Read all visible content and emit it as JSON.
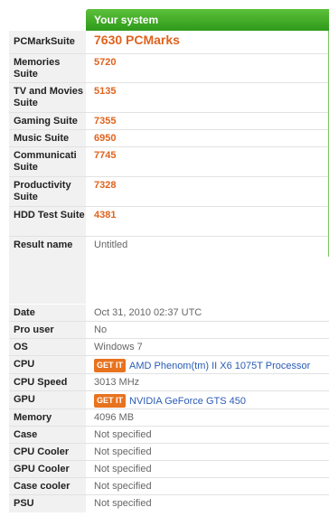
{
  "header": {
    "title": "Your system"
  },
  "results": {
    "pcmark": {
      "label": "PCMarkSuite",
      "value": "7630 PCMarks"
    },
    "memories": {
      "label": "Memories Suite",
      "value": "5720"
    },
    "tv_movies": {
      "label": "TV and Movies Suite",
      "value": "5135"
    },
    "gaming": {
      "label": "Gaming Suite",
      "value": "7355"
    },
    "music": {
      "label": "Music Suite",
      "value": "6950"
    },
    "communication": {
      "label": "Communicati Suite",
      "value": "7745"
    },
    "productivity": {
      "label": "Productivity Suite",
      "value": "7328"
    },
    "hdd": {
      "label": "HDD Test Suite",
      "value": "4381"
    },
    "result_name": {
      "label": "Result name",
      "value": "Untitled"
    }
  },
  "system": {
    "date": {
      "label": "Date",
      "value": "Oct 31, 2010 02:37 UTC"
    },
    "pro_user": {
      "label": "Pro user",
      "value": "No"
    },
    "os": {
      "label": "OS",
      "value": "Windows 7"
    },
    "cpu": {
      "label": "CPU",
      "badge": "GET IT",
      "value": "AMD Phenom(tm) II X6 1075T Processor"
    },
    "cpu_speed": {
      "label": "CPU Speed",
      "value": "3013 MHz"
    },
    "gpu": {
      "label": "GPU",
      "badge": "GET IT",
      "value": "NVIDIA GeForce GTS 450"
    },
    "memory": {
      "label": "Memory",
      "value": "4096 MB"
    },
    "case": {
      "label": "Case",
      "value": "Not specified"
    },
    "cpu_cooler": {
      "label": "CPU Cooler",
      "value": "Not specified"
    },
    "gpu_cooler": {
      "label": "GPU Cooler",
      "value": "Not specified"
    },
    "case_cooler": {
      "label": "Case cooler",
      "value": "Not specified"
    },
    "psu": {
      "label": "PSU",
      "value": "Not specified"
    }
  },
  "colors": {
    "header_green": "#3aa823",
    "score_orange": "#e0631e",
    "link_blue": "#2a5bb5",
    "badge_orange": "#e8731f"
  }
}
